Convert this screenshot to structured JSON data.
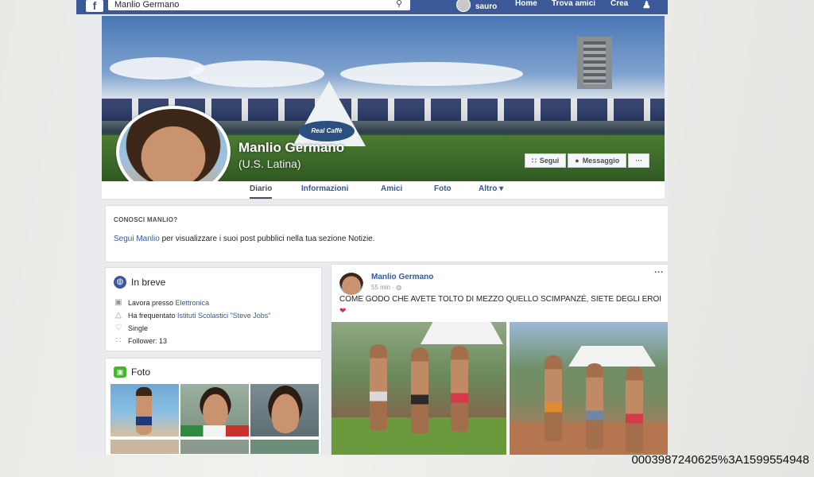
{
  "topbar": {
    "search_value": "Manlio Germano",
    "user_name": "sauro",
    "nav": [
      "Home",
      "Trova amici",
      "Crea"
    ]
  },
  "cover": {
    "name": "Manlio Germano",
    "alternate_name": "(U.S. Latina)",
    "sponsor_text": "Real Caffè",
    "follow_label": "Segui",
    "message_label": "Messaggio",
    "more_label": "···"
  },
  "tabs": [
    "Diario",
    "Informazioni",
    "Amici",
    "Foto",
    "Altro ▾"
  ],
  "know": {
    "title": "CONOSCI MANLIO?",
    "link": "Segui Manlio",
    "text": " per visualizzare i suoi post pubblici nella tua sezione Notizie."
  },
  "intro": {
    "title": "In breve",
    "work_prefix": "Lavora presso ",
    "work_link": "Elettronica",
    "school_prefix": "Ha frequentato ",
    "school_link": "Istituti Scolastici \"Steve Jobs\"",
    "relationship": "Single",
    "followers": "Follower: 13"
  },
  "photos": {
    "title": "Foto"
  },
  "post": {
    "author": "Manlio Germano",
    "time": "55 min ·",
    "text": "COME GODO CHE AVETE TOLTO DI MEZZO QUELLO SCIMPANZÉ, SIETE DEGLI EROI",
    "more": "···"
  },
  "url_fragment": "1000039872406253A1599554948",
  "url_visible": "0003987240625%3A1599554948",
  "icons": {
    "brand": "facebook-logo",
    "search": "search-icon",
    "friends": "friends-icon",
    "rss": "rss-icon",
    "message": "messenger-icon"
  },
  "colors": {
    "brand_blue": "#3b5998",
    "link_blue": "#365899",
    "page_bg": "#e9ebee"
  }
}
